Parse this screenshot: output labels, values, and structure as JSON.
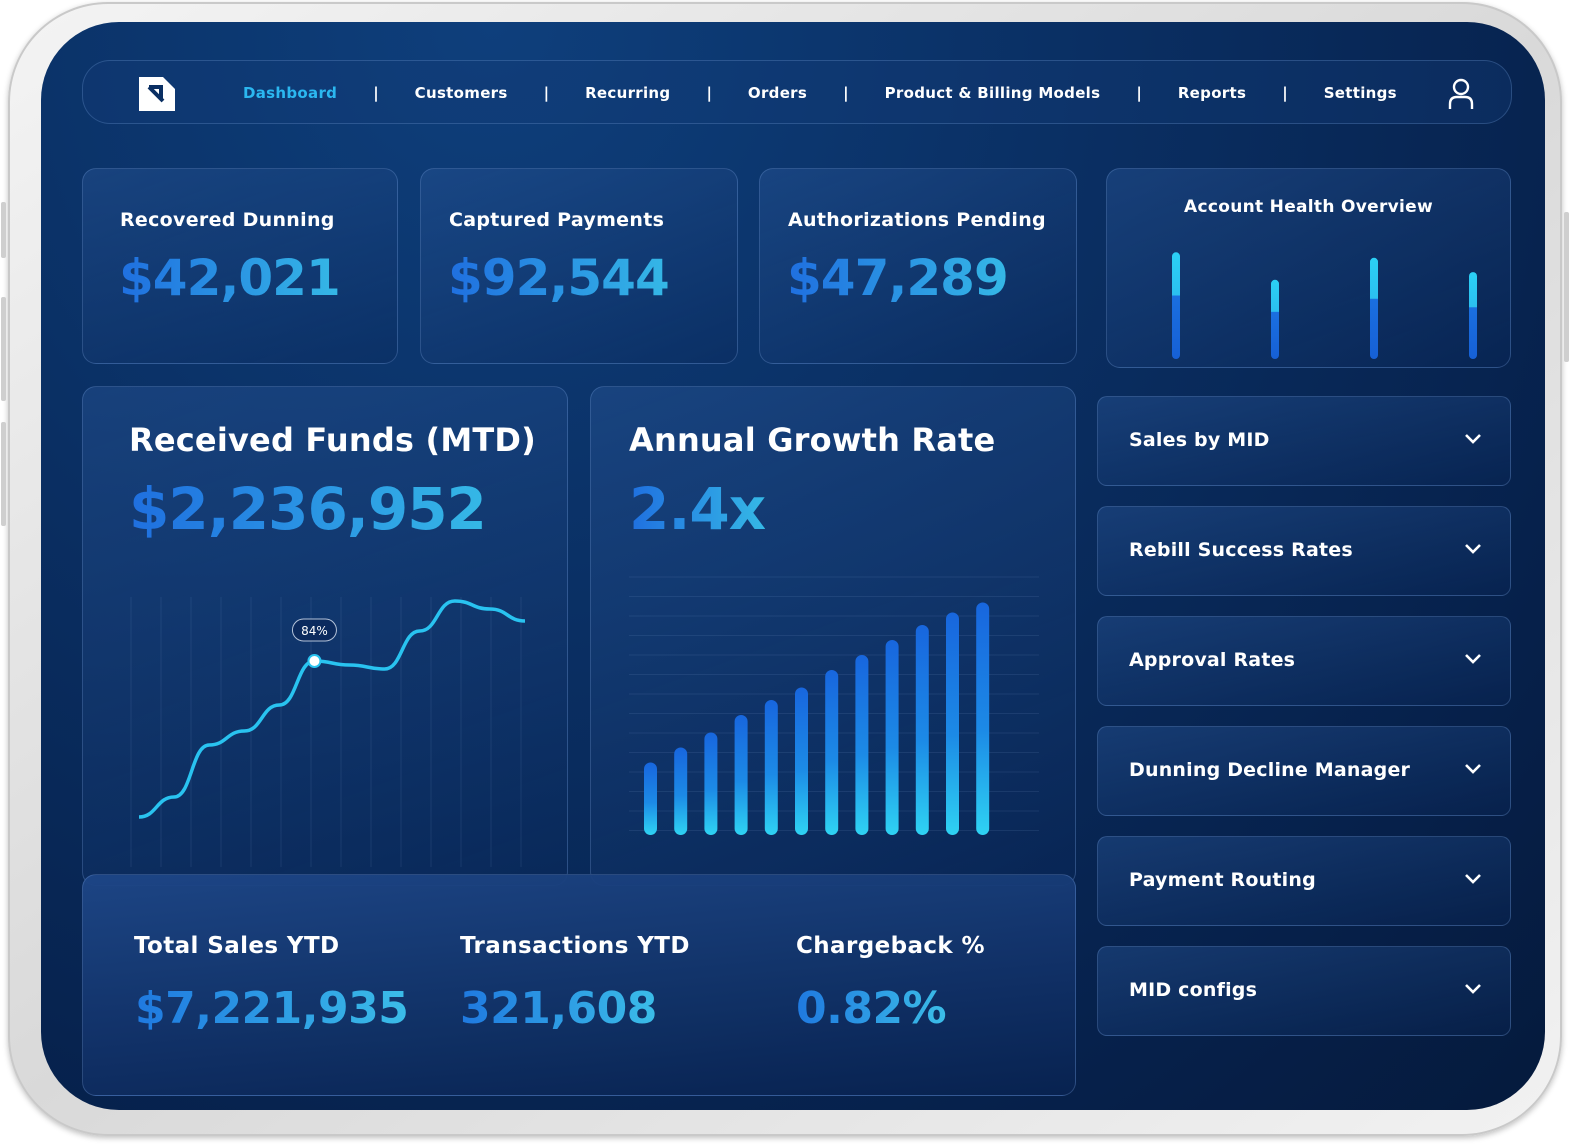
{
  "nav": {
    "items": [
      {
        "label": "Dashboard",
        "active": true
      },
      {
        "label": "Customers",
        "active": false
      },
      {
        "label": "Recurring",
        "active": false
      },
      {
        "label": "Orders",
        "active": false
      },
      {
        "label": "Product & Billing Models",
        "active": false
      },
      {
        "label": "Reports",
        "active": false
      },
      {
        "label": "Settings",
        "active": false
      }
    ],
    "separator": "|",
    "logo_icon": "logo-icon",
    "user_icon": "user-icon"
  },
  "stats": [
    {
      "title": "Recovered Dunning",
      "value": "$42,021"
    },
    {
      "title": "Captured Payments",
      "value": "$92,544"
    },
    {
      "title": "Authorizations Pending",
      "value": "$47,289"
    }
  ],
  "health": {
    "title": "Account Health Overview",
    "levels": [
      0.97,
      0.72,
      0.92,
      0.79
    ]
  },
  "received_funds": {
    "title": "Received Funds (MTD)",
    "value": "$2,236,952",
    "tooltip": "84%",
    "curve": [
      0.02,
      0.12,
      0.38,
      0.45,
      0.58,
      0.8,
      0.78,
      0.76,
      0.95,
      1.1,
      1.06,
      1.0
    ]
  },
  "growth": {
    "title": "Annual Growth Rate",
    "value": "2.4x",
    "bars": [
      0.29,
      0.35,
      0.41,
      0.48,
      0.54,
      0.59,
      0.66,
      0.72,
      0.78,
      0.84,
      0.89,
      0.93
    ]
  },
  "dropdowns": [
    {
      "label": "Sales by MID"
    },
    {
      "label": "Rebill Success Rates"
    },
    {
      "label": "Approval Rates"
    },
    {
      "label": "Dunning Decline Manager"
    },
    {
      "label": "Payment Routing"
    },
    {
      "label": "MID configs"
    }
  ],
  "summary": [
    {
      "title": "Total Sales YTD",
      "value": "$7,221,935"
    },
    {
      "title": "Transactions YTD",
      "value": "321,608"
    },
    {
      "title": "Chargeback %",
      "value": "0.82%"
    }
  ],
  "colors": {
    "accent": "#2bb7f0",
    "primary": "#1f6fe0",
    "background": "#0a2f63"
  }
}
